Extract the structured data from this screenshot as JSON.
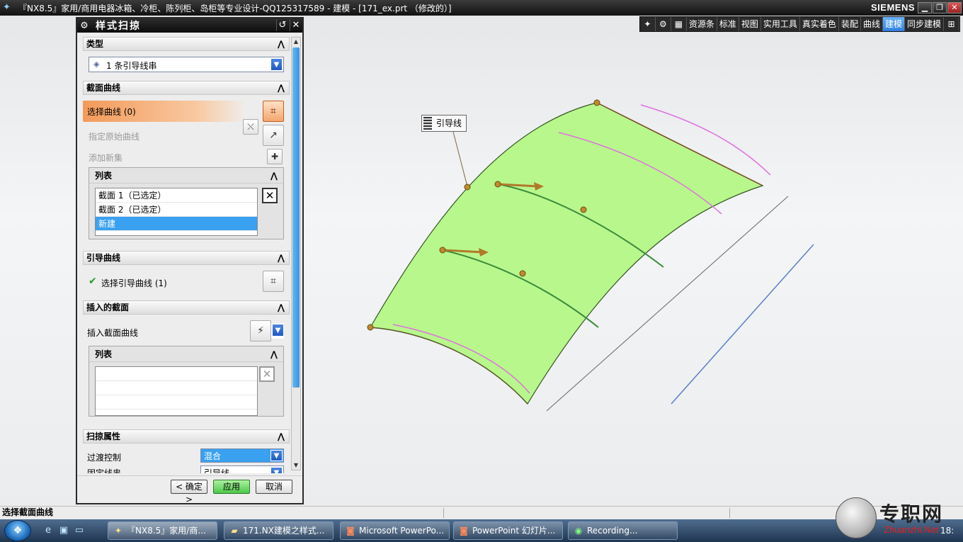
{
  "window": {
    "title": "『NX8.5』家用/商用电器冰箱、冷柜、陈列柜、岛柜等专业设计-QQ125317589 - 建模 - [171_ex.prt （修改的）]",
    "brand": "SIEMENS",
    "min": "▁",
    "restore": "❐",
    "close": "✕"
  },
  "ribbon": {
    "items": [
      "资源条",
      "标准",
      "视图",
      "实用工具",
      "真实着色",
      "装配",
      "曲线",
      "建模",
      "同步建模"
    ],
    "active": "建模",
    "active_color": "#3b8fef"
  },
  "dialog": {
    "title": "样式扫掠",
    "type_section": {
      "header": "类型",
      "combo_value": "1 条引导线串"
    },
    "section_curves": {
      "header": "截面曲线",
      "select_curve": "选择曲线 (0)",
      "specify_original": "指定原始曲线",
      "add_new_set": "添加新集",
      "list_header": "列表",
      "list_rows": [
        "截面 1（已选定）",
        "截面 2（已选定）",
        "新建"
      ]
    },
    "guide_curves": {
      "header": "引导曲线",
      "select_guide": "选择引导曲线 (1)"
    },
    "inserted_sections": {
      "header": "插入的截面",
      "insert_label": "插入截面曲线",
      "list_header": "列表"
    },
    "sweep_props": {
      "header": "扫掠属性",
      "transition_label": "过渡控制",
      "transition_value": "混合",
      "fixed_label": "固定线串",
      "fixed_value": "引导线"
    },
    "buttons": {
      "ok": "< 确定 >",
      "apply": "应用",
      "cancel": "取消"
    }
  },
  "viewport": {
    "tooltip": "引导线",
    "surface_color": "#b8f78c",
    "guide_color": "#3c8a3c",
    "curve_magenta": "#e070e0",
    "line_blue": "#5a7fc8"
  },
  "statusbar": {
    "prompt": "选择截面曲线"
  },
  "taskbar": {
    "tasks": [
      "『NX8.5』家用/商...",
      "171.NX建模之样式...",
      "Microsoft PowerPo...",
      "PowerPoint 幻灯片...",
      "Recording..."
    ],
    "clock": "18:"
  },
  "watermark": {
    "cn": "专职网",
    "en": "Zhuanzhi.Net"
  }
}
